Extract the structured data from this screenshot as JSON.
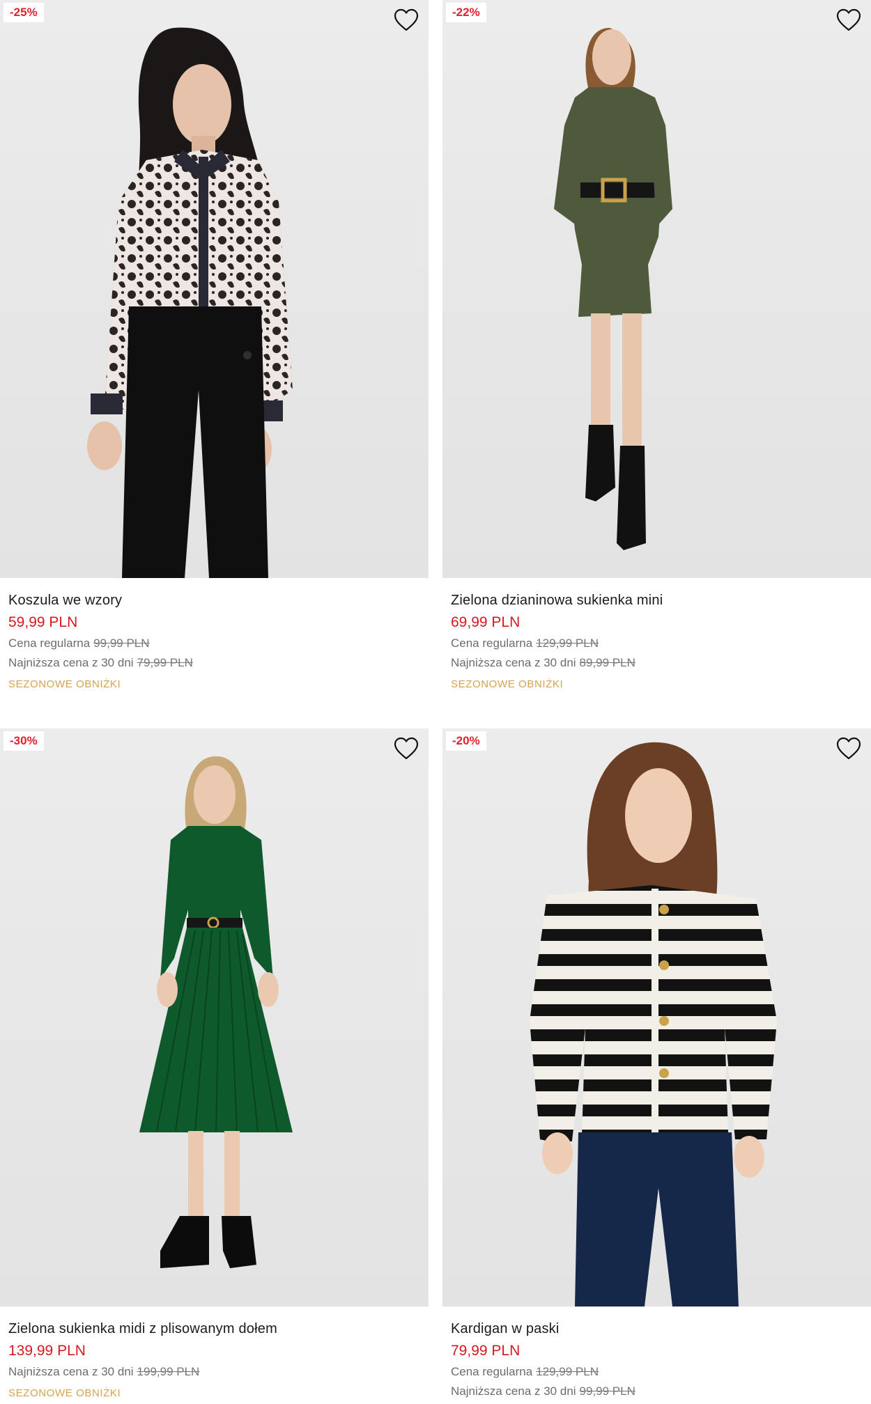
{
  "colors": {
    "price": "#d7191f",
    "badge_text": "#e3202f",
    "promo": "#d8a24a"
  },
  "products": [
    {
      "badge": "-25%",
      "name": "Koszula we wzory",
      "price": "59,99 PLN",
      "regular_label": "Cena regularna",
      "regular_price": "99,99 PLN",
      "lowest_label": "Najniższa cena z 30 dni",
      "lowest_price": "79,99 PLN",
      "promo": "SEZONOWE OBNIŻKI",
      "icon": "heart-outline-icon"
    },
    {
      "badge": "-22%",
      "name": "Zielona dzianinowa sukienka mini",
      "price": "69,99 PLN",
      "regular_label": "Cena regularna",
      "regular_price": "129,99 PLN",
      "lowest_label": "Najniższa cena z 30 dni",
      "lowest_price": "89,99 PLN",
      "promo": "SEZONOWE OBNIŻKI",
      "icon": "heart-outline-icon"
    },
    {
      "badge": "-30%",
      "name": "Zielona sukienka midi z plisowanym dołem",
      "price": "139,99 PLN",
      "lowest_label": "Najniższa cena z 30 dni",
      "lowest_price": "199,99 PLN",
      "promo": "SEZONOWE OBNIŻKI",
      "icon": "heart-outline-icon"
    },
    {
      "badge": "-20%",
      "name": "Kardigan w paski",
      "price": "79,99 PLN",
      "regular_label": "Cena regularna",
      "regular_price": "129,99 PLN",
      "lowest_label": "Najniższa cena z 30 dni",
      "lowest_price": "99,99 PLN",
      "icon": "heart-outline-icon"
    }
  ]
}
